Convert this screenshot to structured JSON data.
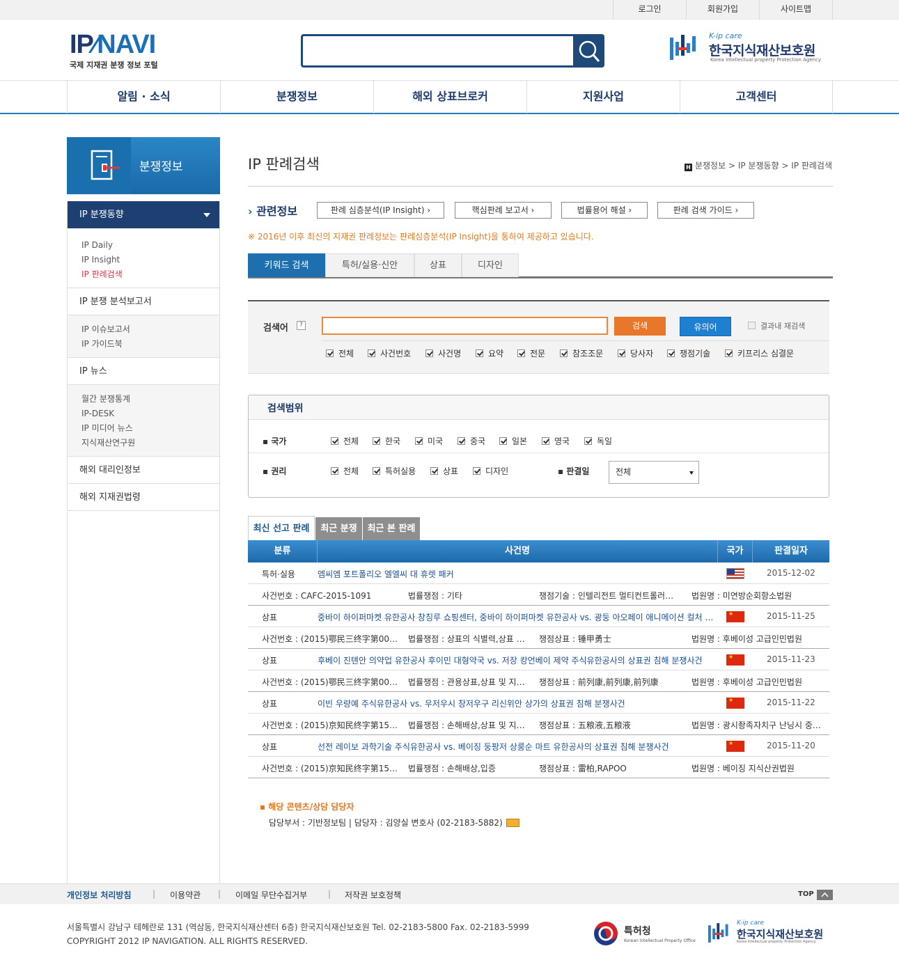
{
  "util": {
    "login": "로그인",
    "join": "회원가입",
    "sitemap": "사이트맵"
  },
  "logo": {
    "main_a": "IP",
    "main_b": "NAVI",
    "sub": "국제 지재권 분쟁 정보 포털"
  },
  "search": {
    "value": ""
  },
  "partner": {
    "tag": "K-ip care",
    "name": "한국지식재산보호원",
    "eng": "Korea Intellectual property Protection Agency"
  },
  "gnb": [
    "알림 · 소식",
    "분쟁정보",
    "해외 상표브로커",
    "지원사업",
    "고객센터"
  ],
  "lnb": {
    "title": "분쟁정보",
    "current": "IP 분쟁동향",
    "group1": [
      "IP Daily",
      "IP Insight",
      "IP 판례검색"
    ],
    "item_report": "IP 분쟁 분석보고서",
    "group2": [
      "IP 이슈보고서",
      "IP 가이드북"
    ],
    "item_news": "IP 뉴스",
    "group3": [
      "월간 분쟁통계",
      "IP-DESK",
      "IP 미디어 뉴스",
      "지식재산연구원"
    ],
    "item_agent": "해외 대리인정보",
    "item_law": "해외 지재권법령"
  },
  "page": {
    "title": "IP 판례검색",
    "breadcrumb": "분쟁정보 > IP 분쟁동향 > IP 판례검색",
    "home_icon": "H"
  },
  "related": {
    "label": "관련정보",
    "buttons": [
      "판례 심층분석(IP Insight) ›",
      "핵심판례 보고서 ›",
      "법률용어 해설 ›",
      "판례 검색 가이드 ›"
    ]
  },
  "notice": "※ 2016년 이후 최신의 지재권 판례정보는 판례심층분석(IP Insight)을 통하여 제공하고 있습니다.",
  "tabs": [
    "키워드 검색",
    "특허/실용·신안",
    "상표",
    "디자인"
  ],
  "searchform": {
    "label": "검색어",
    "help": "?",
    "search_btn": "검색",
    "synonym_btn": "유의어",
    "research": "결과내 재검색",
    "fields": [
      "전체",
      "사건번호",
      "사건명",
      "요약",
      "전문",
      "참조조문",
      "당사자",
      "쟁점기술",
      "키프리스 심결문"
    ]
  },
  "scope": {
    "title": "검색범위",
    "country_label": "국가",
    "countries": [
      "전체",
      "한국",
      "미국",
      "중국",
      "일본",
      "영국",
      "독일"
    ],
    "right_label": "권리",
    "rights": [
      "전체",
      "특허실용",
      "상표",
      "디자인"
    ],
    "date_label": "판결일",
    "date_value": "전체"
  },
  "result_tabs": [
    "최신 선고 판례",
    "최근 분쟁",
    "최근 본 판례"
  ],
  "table": {
    "headers": [
      "분류",
      "사건명",
      "국가",
      "판결일자"
    ],
    "rows": [
      {
        "cat": "특허·실용",
        "title": "엠씨엠 포트폴리오 엘엘씨 대 휴렛 패커",
        "flag": "us",
        "date": "2015-12-02",
        "case_no": "사건번호 : CAFC-2015-1091",
        "issue": "법률쟁점 : 기타",
        "tech": "쟁점기술 : 인텔리전트 멀티컨트롤러…",
        "court": "법원명 : 미연방순회항소법원"
      },
      {
        "cat": "상표",
        "title": "중바이 하이퍼마켓 유한공사 창칭루 쇼핑센터, 중바이 하이퍼마켓 유한공사 vs. 광둥 아오페이 애니메이션 컬처 …",
        "flag": "cn",
        "date": "2015-11-25",
        "case_no": "사건번호 : (2015)鄂民三终字第00…",
        "issue": "법률쟁점 : 상표의 식별력,상표 및 …",
        "tech": "쟁점상표 : 锤甲勇士",
        "court": "법원명 : 후베이성 고급인민법원"
      },
      {
        "cat": "상표",
        "title": "후베이 진톈안 의약업 유한공사 후이민 대형약국 vs. 저장 캉언베이 제약 주식유한공사의 상표권 침해 분쟁사건",
        "flag": "cn",
        "date": "2015-11-23",
        "case_no": "사건번호 : (2015)鄂民三终字第00…",
        "issue": "법률쟁점 : 관용상표,상표 및 지정…",
        "tech": "쟁점상표 : 前列康,前列康,前列康",
        "court": "법원명 : 후베이성 고급인민법원"
      },
      {
        "cat": "상표",
        "title": "이빈 우량예 주식유한공사 vs. 우저우시 창저우구 리신위안 상가의 상표권 침해 분쟁사건",
        "flag": "cn",
        "date": "2015-11-22",
        "case_no": "사건번호 : (2015)京知民终字第15…",
        "issue": "법률쟁점 : 손해배상,상표 및 지정…",
        "tech": "쟁점상표 : 五粮液,五粮液",
        "court": "법원명 : 광시좡족자치구 난닝시 중급…"
      },
      {
        "cat": "상표",
        "title": "선전 레이보 과학기술 주식유한공사 vs. 베이징 둥팡저 상룽순 마트 유한공사의 상표권 침해 분쟁사건",
        "flag": "cn",
        "date": "2015-11-20",
        "case_no": "사건번호 : (2015)京知民终字第15…",
        "issue": "법률쟁점 : 손해배상,입증",
        "tech": "쟁점상표 : 雷柏,RAPOO",
        "court": "법원명 : 베이징 지식산권법원"
      }
    ]
  },
  "contact": {
    "title": "해당 콘텐츠/상담 담당자",
    "detail": "담당부서 : 기반정보팀 | 담당자 : 김양실 변호사 (02-2183-5882)"
  },
  "footer": {
    "links": [
      "개인정보 처리방침",
      "이용약관",
      "이메일 무단수집거부",
      "저작권 보호정책"
    ],
    "top": "TOP",
    "address": "서울특별시 강남구 테헤란로 131 (역삼동, 한국지식재산센터 6층) 한국지식재산보호원 Tel. 02-2183-5800 Fax. 02-2183-5999",
    "copyright": "COPYRIGHT 2012 IP NAVIGATION. ALL RIGHTS RESERVED.",
    "kipo_name": "특허청",
    "kipo_eng": "Korean Intellectual Property Office"
  }
}
